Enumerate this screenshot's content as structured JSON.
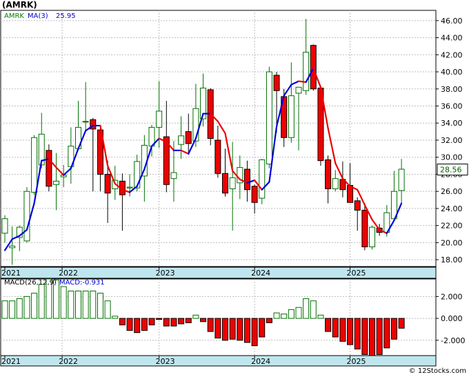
{
  "title": "(AMRK)",
  "footer": "© 12Stocks.com",
  "chart_data": [
    {
      "type": "candlestick",
      "ticker": "AMRK",
      "legend": [
        {
          "label": "AMRK",
          "color": "#008000"
        },
        {
          "label": "MA(3)",
          "color": "#0000cc"
        },
        {
          "label": "25.95",
          "color": "#0000cc"
        }
      ],
      "last_price": "28.56",
      "ylim": [
        17.2,
        47.2
      ],
      "yticks": [
        "18.00",
        "20.00",
        "22.00",
        "24.00",
        "26.00",
        "28.00",
        "30.00",
        "32.00",
        "34.00",
        "36.00",
        "38.00",
        "40.00",
        "42.00",
        "44.00",
        "46.00"
      ],
      "x_labels": [
        "2021",
        "2022",
        "2023",
        "2024",
        "2025"
      ],
      "candles": [
        [
          21.1,
          23.2,
          20.0,
          22.8
        ],
        [
          19.4,
          21.9,
          17.4,
          19.6
        ],
        [
          20.6,
          22.0,
          19.0,
          21.8
        ],
        [
          20.2,
          26.5,
          20.0,
          26.0
        ],
        [
          25.9,
          32.6,
          25.6,
          32.3
        ],
        [
          29.1,
          35.2,
          28.7,
          32.7
        ],
        [
          30.8,
          31.5,
          26.0,
          26.6
        ],
        [
          26.8,
          30.5,
          23.8,
          27.2
        ],
        [
          27.7,
          29.1,
          26.5,
          27.9
        ],
        [
          28.9,
          33.5,
          26.9,
          31.3
        ],
        [
          31.0,
          36.6,
          30.8,
          33.5
        ],
        [
          34.2,
          38.8,
          33.0,
          34.2
        ],
        [
          34.4,
          34.6,
          26.0,
          33.3
        ],
        [
          33.2,
          33.4,
          26.0,
          28.0
        ],
        [
          28.0,
          29.6,
          22.3,
          25.8
        ],
        [
          26.3,
          29.0,
          25.0,
          27.3
        ],
        [
          27.2,
          28.1,
          21.4,
          25.6
        ],
        [
          26.4,
          28.0,
          25.4,
          26.5
        ],
        [
          26.4,
          30.3,
          26.0,
          29.5
        ],
        [
          27.8,
          32.6,
          24.8,
          31.4
        ],
        [
          31.3,
          33.8,
          30.1,
          33.5
        ],
        [
          33.5,
          38.9,
          31.1,
          35.4
        ],
        [
          32.4,
          36.6,
          25.9,
          26.8
        ],
        [
          27.5,
          31.9,
          24.8,
          28.2
        ],
        [
          31.5,
          34.8,
          29.8,
          32.5
        ],
        [
          33.0,
          35.1,
          30.3,
          31.6
        ],
        [
          31.9,
          38.6,
          31.2,
          35.7
        ],
        [
          34.5,
          39.8,
          33.6,
          38.1
        ],
        [
          37.9,
          38.1,
          31.4,
          32.2
        ],
        [
          32.0,
          33.7,
          27.6,
          28.1
        ],
        [
          28.1,
          31.0,
          25.4,
          25.8
        ],
        [
          26.3,
          31.8,
          21.4,
          27.6
        ],
        [
          27.0,
          30.2,
          25.1,
          28.8
        ],
        [
          28.6,
          29.6,
          24.8,
          26.2
        ],
        [
          26.6,
          26.8,
          23.4,
          24.7
        ],
        [
          25.2,
          29.8,
          24.5,
          29.7
        ],
        [
          29.2,
          40.6,
          28.7,
          40.0
        ],
        [
          39.6,
          40.0,
          32.9,
          37.8
        ],
        [
          37.1,
          38.0,
          31.2,
          32.3
        ],
        [
          32.3,
          41.1,
          31.7,
          37.2
        ],
        [
          37.5,
          37.9,
          30.8,
          38.2
        ],
        [
          37.8,
          46.2,
          37.3,
          42.3
        ],
        [
          43.1,
          43.2,
          37.8,
          38.0
        ],
        [
          38.1,
          38.2,
          29.0,
          29.6
        ],
        [
          29.7,
          30.2,
          24.6,
          26.3
        ],
        [
          26.3,
          28.5,
          26.0,
          27.5
        ],
        [
          27.4,
          29.5,
          25.3,
          26.2
        ],
        [
          26.7,
          29.3,
          25.4,
          24.7
        ],
        [
          24.9,
          25.3,
          21.4,
          23.8
        ],
        [
          23.8,
          24.6,
          19.1,
          19.5
        ],
        [
          19.5,
          22.0,
          19.2,
          21.8
        ],
        [
          21.7,
          22.2,
          20.8,
          21.2
        ],
        [
          21.2,
          24.4,
          20.7,
          23.5
        ],
        [
          22.8,
          28.4,
          22.5,
          26.0
        ],
        [
          26.1,
          29.8,
          24.6,
          28.6
        ]
      ],
      "ma3": [
        19.1,
        20.4,
        20.8,
        21.5,
        24.6,
        29.6,
        29.8,
        28.8,
        27.9,
        28.7,
        31.0,
        33.1,
        33.7,
        33.7,
        29.0,
        26.9,
        26.2,
        25.9,
        26.6,
        28.6,
        31.3,
        32.2,
        31.8,
        30.8,
        30.8,
        30.4,
        32.2,
        35.1,
        35.1,
        34.2,
        32.8,
        28.4,
        27.4,
        27.0,
        27.3,
        26.2,
        27.1,
        33.6,
        37.2,
        38.5,
        38.9,
        38.8,
        40.4,
        38.2,
        33.4,
        29.3,
        27.5,
        26.6,
        26.2,
        24.4,
        22.7,
        21.5,
        21.1,
        22.6,
        24.6,
        26.1
      ],
      "macd": {
        "label": "MACD(26,12,9)",
        "value_label": "MACD:-0.931",
        "ylim": [
          -3.4,
          3.6
        ],
        "yticks": [
          "2.000",
          "0.000",
          "-2.000"
        ],
        "x_labels": [
          "2021",
          "2022",
          "2023",
          "2024",
          "2025"
        ],
        "values": [
          1.6,
          1.6,
          1.8,
          2.0,
          2.3,
          3.1,
          3.6,
          3.5,
          2.9,
          2.5,
          2.5,
          2.5,
          2.5,
          2.3,
          1.6,
          0.2,
          -0.6,
          -1.1,
          -1.3,
          -1.1,
          -0.6,
          -0.1,
          -0.7,
          -0.7,
          -0.5,
          -0.4,
          0.3,
          -0.3,
          -1.2,
          -1.8,
          -2.0,
          -1.9,
          -2.0,
          -2.2,
          -2.5,
          -1.7,
          -0.4,
          0.5,
          0.4,
          0.8,
          1.0,
          1.8,
          1.6,
          0.3,
          -1.2,
          -1.7,
          -2.1,
          -2.4,
          -2.8,
          -3.3,
          -3.4,
          -3.3,
          -2.7,
          -1.9,
          -0.9
        ]
      }
    }
  ]
}
